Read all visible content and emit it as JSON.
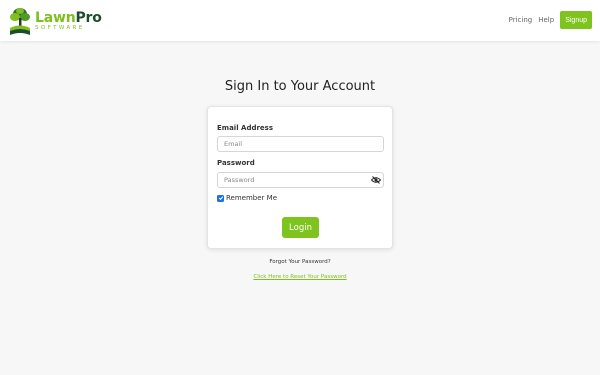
{
  "brand": {
    "name_part1": "Lawn",
    "name_part2": "Pro",
    "tagline": "SOFTWARE",
    "colors": {
      "lawn_green": "#7fbf1f",
      "pro_dark_green": "#1e4d2b",
      "accent_button": "#7fc41e"
    }
  },
  "nav": {
    "links": [
      {
        "label": "Pricing"
      },
      {
        "label": "Help"
      }
    ],
    "signup_label": "Signup"
  },
  "page": {
    "title": "Sign In to Your Account"
  },
  "form": {
    "email_label": "Email Address",
    "email_placeholder": "Email",
    "email_value": "",
    "password_label": "Password",
    "password_placeholder": "Password",
    "password_value": "",
    "password_toggle_icon": "eye-slash-icon",
    "remember_label": "Remember Me",
    "remember_checked": true,
    "login_label": "Login"
  },
  "recovery": {
    "forgot_text": "Forgot Your Password?",
    "reset_link_text": "Click Here to Reset Your Password"
  }
}
